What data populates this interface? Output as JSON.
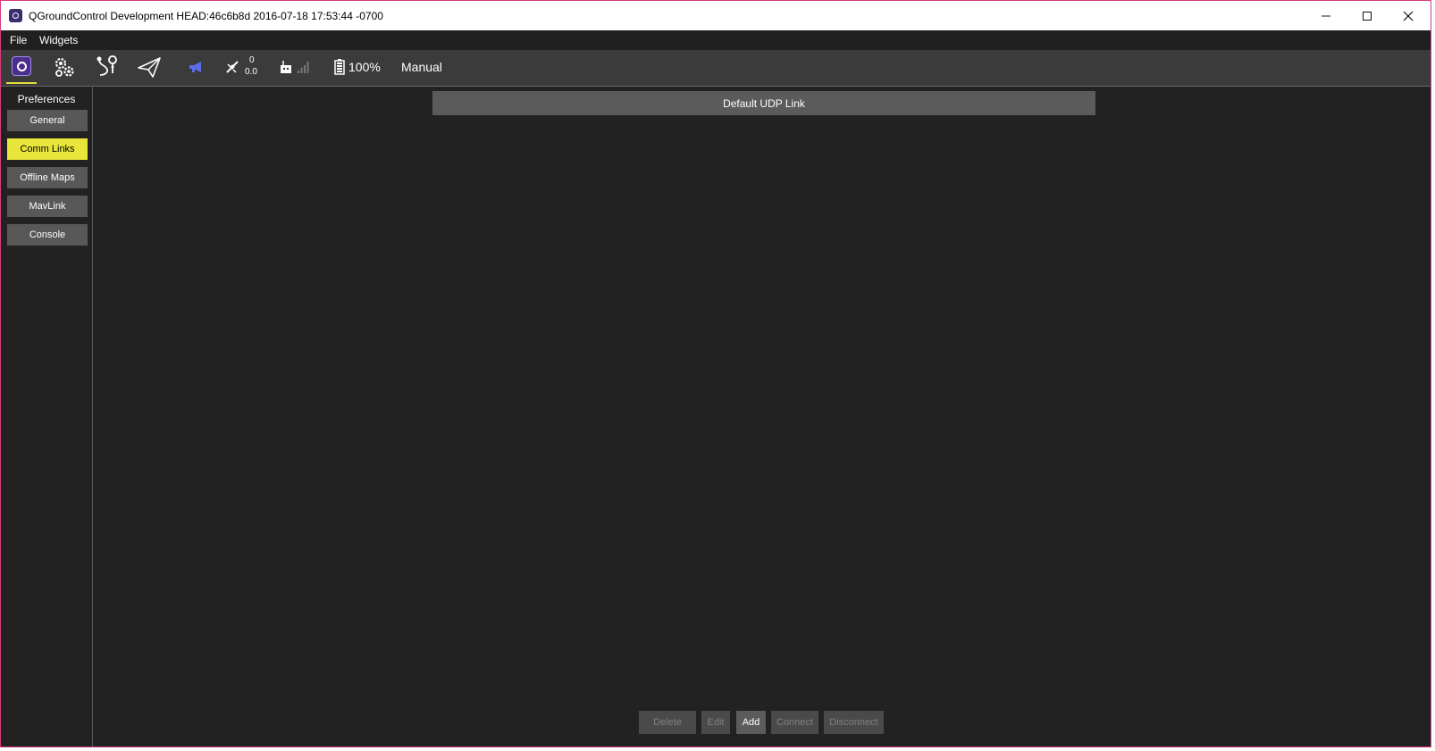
{
  "window": {
    "title": "QGroundControl Development HEAD:46c6b8d 2016-07-18 17:53:44 -0700"
  },
  "menu": {
    "items": [
      "File",
      "Widgets"
    ]
  },
  "toolbar": {
    "gps_count": "0",
    "gps_hdop": "0.0",
    "battery": "100%",
    "flight_mode": "Manual"
  },
  "sidebar": {
    "title": "Preferences",
    "items": [
      {
        "label": "General",
        "active": false
      },
      {
        "label": "Comm Links",
        "active": true
      },
      {
        "label": "Offline Maps",
        "active": false
      },
      {
        "label": "MavLink",
        "active": false
      },
      {
        "label": "Console",
        "active": false
      }
    ]
  },
  "links": [
    {
      "name": "Default UDP Link"
    }
  ],
  "actions": {
    "delete": "Delete",
    "edit": "Edit",
    "add": "Add",
    "connect": "Connect",
    "disconnect": "Disconnect"
  },
  "colors": {
    "accent": "#e8e63a",
    "background": "#222222",
    "button": "#585858",
    "window_border": "#d8397b"
  }
}
